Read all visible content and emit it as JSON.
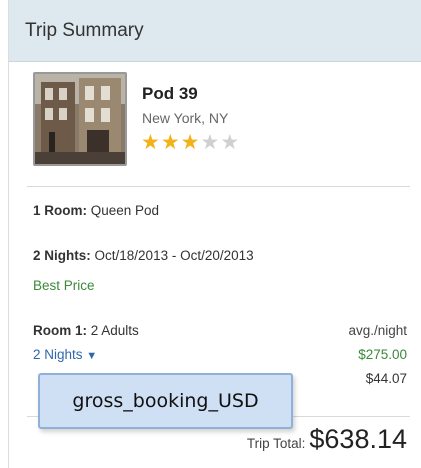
{
  "header": {
    "title": "Trip Summary"
  },
  "hotel": {
    "name": "Pod 39",
    "location": "New York, NY",
    "rating": 3,
    "rating_max": 5
  },
  "room": {
    "label": "1 Room:",
    "value": "Queen Pod"
  },
  "stay": {
    "nights_label": "2 Nights:",
    "dates": "Oct/18/2013 - Oct/20/2013",
    "best_price": "Best Price"
  },
  "pricing": {
    "room_label": "Room 1:",
    "room_guests": "2 Adults",
    "avg_night_label": "avg./night",
    "nights_toggle": "2 Nights",
    "nightly_price": "$275.00",
    "taxes_amount": "$44.07"
  },
  "tooltip": {
    "text": "gross_booking_USD"
  },
  "total": {
    "label": "Trip Total:",
    "amount": "$638.14"
  },
  "colors": {
    "header_bg": "#dde9ee",
    "price_green": "#3a8a3a",
    "link_blue": "#2f67a8",
    "star_gold": "#f3b21a",
    "tooltip_bg": "#cfe0f4"
  }
}
